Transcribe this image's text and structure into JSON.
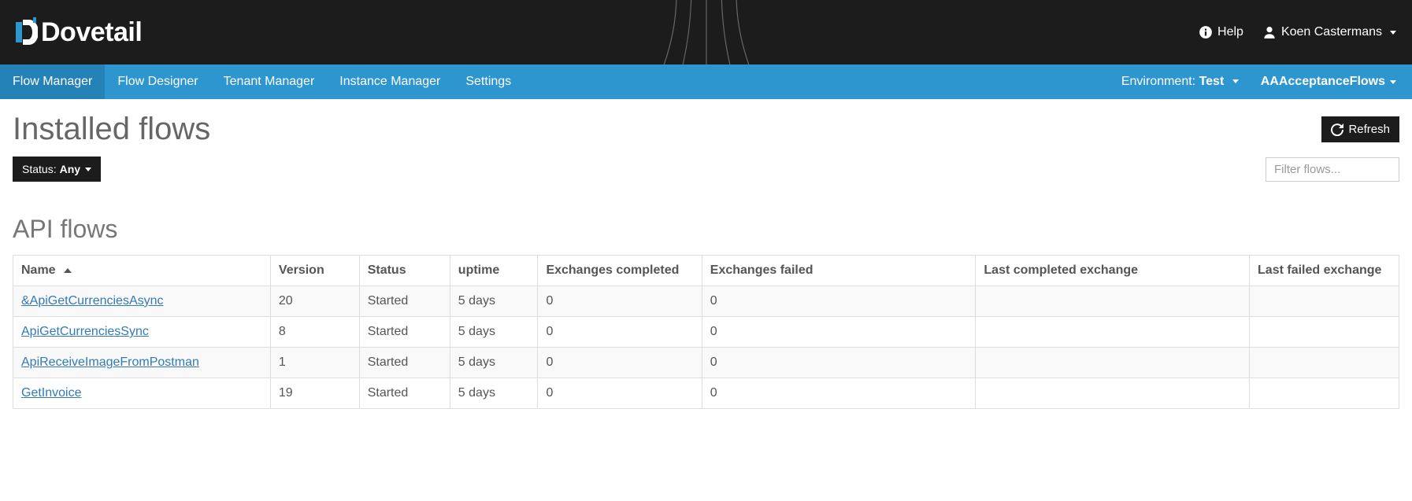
{
  "brand": {
    "name": "Dovetail"
  },
  "topbar": {
    "help_label": "Help",
    "user_name": "Koen Castermans"
  },
  "nav": {
    "items": [
      {
        "label": "Flow Manager",
        "active": true
      },
      {
        "label": "Flow Designer",
        "active": false
      },
      {
        "label": "Tenant Manager",
        "active": false
      },
      {
        "label": "Instance Manager",
        "active": false
      },
      {
        "label": "Settings",
        "active": false
      }
    ],
    "environment_label": "Environment:",
    "environment_value": "Test",
    "tenant": "AAAcceptanceFlows"
  },
  "page": {
    "title": "Installed flows",
    "refresh_label": "Refresh",
    "status_filter_label": "Status:",
    "status_filter_value": "Any",
    "filter_placeholder": "Filter flows..."
  },
  "section": {
    "title": "API flows"
  },
  "table": {
    "columns": {
      "name": "Name",
      "version": "Version",
      "status": "Status",
      "uptime": "uptime",
      "exchanges_completed": "Exchanges completed",
      "exchanges_failed": "Exchanges failed",
      "last_completed_exchange": "Last completed exchange",
      "last_failed_exchange": "Last failed exchange"
    },
    "sort": {
      "column": "name",
      "dir": "asc"
    },
    "rows": [
      {
        "name": "&ApiGetCurrenciesAsync",
        "version": "20",
        "status": "Started",
        "uptime": "5 days",
        "exchanges_completed": "0",
        "exchanges_failed": "0",
        "last_completed_exchange": "",
        "last_failed_exchange": ""
      },
      {
        "name": "ApiGetCurrenciesSync",
        "version": "8",
        "status": "Started",
        "uptime": "5 days",
        "exchanges_completed": "0",
        "exchanges_failed": "0",
        "last_completed_exchange": "",
        "last_failed_exchange": ""
      },
      {
        "name": "ApiReceiveImageFromPostman",
        "version": "1",
        "status": "Started",
        "uptime": "5 days",
        "exchanges_completed": "0",
        "exchanges_failed": "0",
        "last_completed_exchange": "",
        "last_failed_exchange": ""
      },
      {
        "name": "GetInvoice",
        "version": "19",
        "status": "Started",
        "uptime": "5 days",
        "exchanges_completed": "0",
        "exchanges_failed": "0",
        "last_completed_exchange": "",
        "last_failed_exchange": ""
      }
    ]
  }
}
